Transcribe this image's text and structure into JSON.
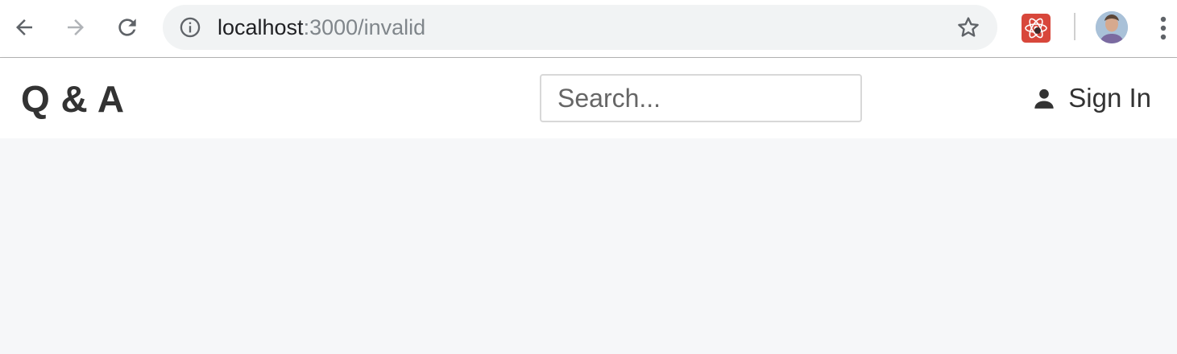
{
  "browser": {
    "url_host": "localhost",
    "url_path": ":3000/invalid",
    "icons": {
      "back": "back-arrow-icon",
      "forward": "forward-arrow-icon",
      "reload": "reload-icon",
      "info": "info-icon",
      "bookmark": "star-icon",
      "extension": "react-devtools-extension-icon",
      "profile": "profile-avatar",
      "menu": "kebab-menu-icon"
    }
  },
  "header": {
    "brand": "Q & A",
    "search": {
      "placeholder": "Search...",
      "value": ""
    },
    "signin_label": "Sign In"
  },
  "colors": {
    "page_background": "#f6f7f9",
    "header_background": "#ffffff",
    "text": "#333333",
    "extension_red": "#d8473b"
  }
}
